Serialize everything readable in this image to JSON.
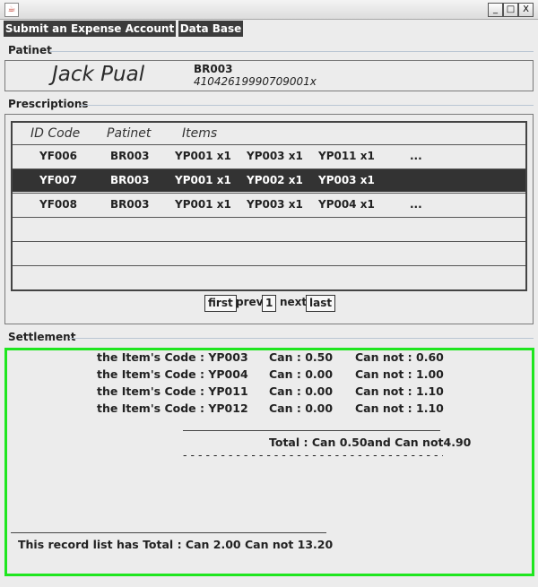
{
  "window": {
    "icon": "java-icon",
    "controls": [
      "_",
      "□",
      "X"
    ]
  },
  "menu": {
    "submit": "Submit an Expense Account",
    "database": "Data Base"
  },
  "patient_section": {
    "title": "Patinet",
    "name": "Jack Pual",
    "id": "BR003",
    "code": "41042619990709001x"
  },
  "prescriptions": {
    "title": "Prescriptions",
    "headers": [
      "ID Code",
      "Patinet",
      "Items"
    ],
    "rows": [
      {
        "id": "YF006",
        "patient": "BR003",
        "i1": "YP001 x1",
        "i2": "YP003 x1",
        "i3": "YP011 x1",
        "more": "..."
      },
      {
        "id": "YF007",
        "patient": "BR003",
        "i1": "YP001 x1",
        "i2": "YP002 x1",
        "i3": "YP003 x1",
        "more": ""
      },
      {
        "id": "YF008",
        "patient": "BR003",
        "i1": "YP001 x1",
        "i2": "YP003 x1",
        "i3": "YP004 x1",
        "more": "..."
      }
    ],
    "selected_row": 1
  },
  "pager": {
    "first": "first",
    "prev": "prev",
    "page": "1",
    "next": "next",
    "last": "last"
  },
  "settlement": {
    "title": "Settlement",
    "items": [
      {
        "code": "the Item's Code : YP003",
        "can": "Can : 0.50",
        "cannot": "Can not : 0.60"
      },
      {
        "code": "the Item's Code : YP004",
        "can": "Can : 0.00",
        "cannot": "Can not : 1.00"
      },
      {
        "code": "the Item's Code : YP011",
        "can": "Can : 0.00",
        "cannot": "Can not : 1.10"
      },
      {
        "code": "the Item's Code : YP012",
        "can": "Can : 0.00",
        "cannot": "Can not : 1.10"
      }
    ],
    "total": "Total : Can 0.50and Can not4.90",
    "dashes": "- - - - - - - - - - - - - - - - - - - - - - - - - - - - - - - - - - -",
    "record_total": "This record list has Total : Can 2.00 Can not 13.20"
  },
  "colors": {
    "selected_row": "#333333",
    "settlement_border": "#1fe61f",
    "menu_bg": "#3c3c3c"
  }
}
